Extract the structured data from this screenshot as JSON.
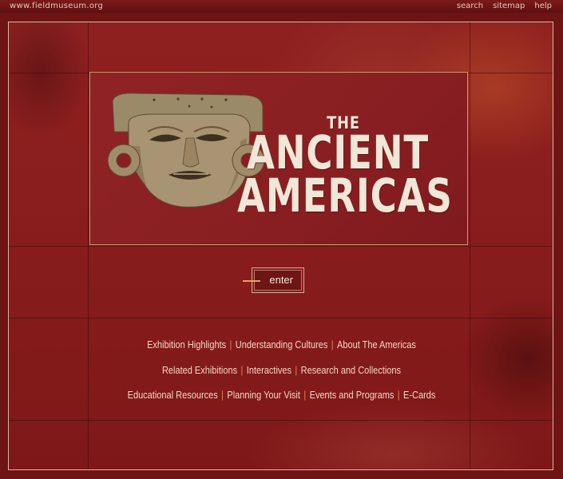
{
  "topbar": {
    "site": "www.fieldmuseum.org",
    "nav": [
      "search",
      "sitemap",
      "help"
    ]
  },
  "hero": {
    "title_the": "THE",
    "title_line1": "ANCIENT",
    "title_line2": "AMERICAS"
  },
  "enter_label": "enter",
  "links": {
    "row1": [
      "Exhibition Highlights",
      "Understanding Cultures",
      "About The Americas"
    ],
    "row2": [
      "Related Exhibitions",
      "Interactives",
      "Research and Collections"
    ],
    "row3": [
      "Educational Resources",
      "Planning Your Visit",
      "Events and Programs",
      "E-Cards"
    ]
  },
  "colors": {
    "background": "#8a1d1d",
    "title": "#f1e7d6",
    "link": "#f3d6c2",
    "accent": "#e8a25a"
  },
  "icons": [
    "stone-mask-image"
  ]
}
